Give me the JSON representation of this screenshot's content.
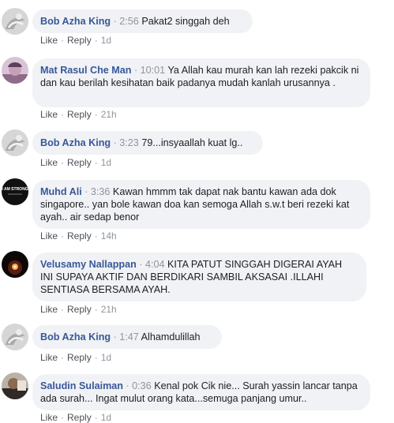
{
  "comments": [
    {
      "author": "Bob Azha King",
      "time": "2:56",
      "text": "Pakat2 singgah deh",
      "like": "Like",
      "reply": "Reply",
      "age": "1d",
      "avatar": "bob"
    },
    {
      "author": "Mat Rasul Che Man",
      "time": "10:01",
      "text": "Ya Allah kau murah kan lah rezeki pakcik ni dan kau berilah kesihatan baik padanya mudah kanlah urusannya .",
      "like": "Like",
      "reply": "Reply",
      "age": "21h",
      "avatar": "mat"
    },
    {
      "author": "Bob Azha King",
      "time": "3:23",
      "text": "79...insyaallah kuat lg..",
      "like": "Like",
      "reply": "Reply",
      "age": "1d",
      "avatar": "bob"
    },
    {
      "author": "Muhd Ali",
      "time": "3:36",
      "text": "Kawan hmmm tak dapat nak bantu kawan ada dok singapore.. yan bole kawan doa kan semoga Allah s.w.t beri rezeki kat ayah.. air sedap benor",
      "like": "Like",
      "reply": "Reply",
      "age": "14h",
      "avatar": "muhd",
      "avatar_text": "I AM STRONG"
    },
    {
      "author": "Velusamy Nallappan",
      "time": "4:04",
      "text": "KITA PATUT SINGGAH DIGERAI AYAH INI SUPAYA AKTIF DAN BERDIKARI SAMBIL AKSASAI .ILLAHI SENTIASA BERSAMA AYAH.",
      "like": "Like",
      "reply": "Reply",
      "age": "21h",
      "avatar": "velu"
    },
    {
      "author": "Bob Azha King",
      "time": "1:47",
      "text": "Alhamdulillah",
      "like": "Like",
      "reply": "Reply",
      "age": "1d",
      "avatar": "bob"
    },
    {
      "author": "Saludin Sulaiman",
      "time": "0:36",
      "text": "Kenal pok Cik nie... Surah yassin lancar tanpa ada surah... Ingat mulut orang kata...semuga panjang umur..",
      "like": "Like",
      "reply": "Reply",
      "age": "1d",
      "avatar": "saludin"
    }
  ],
  "separator": "·",
  "colors": {
    "author": "#385898",
    "bubble": "#f0f2f5",
    "meta": "#90949c",
    "action": "#4b4f56"
  }
}
